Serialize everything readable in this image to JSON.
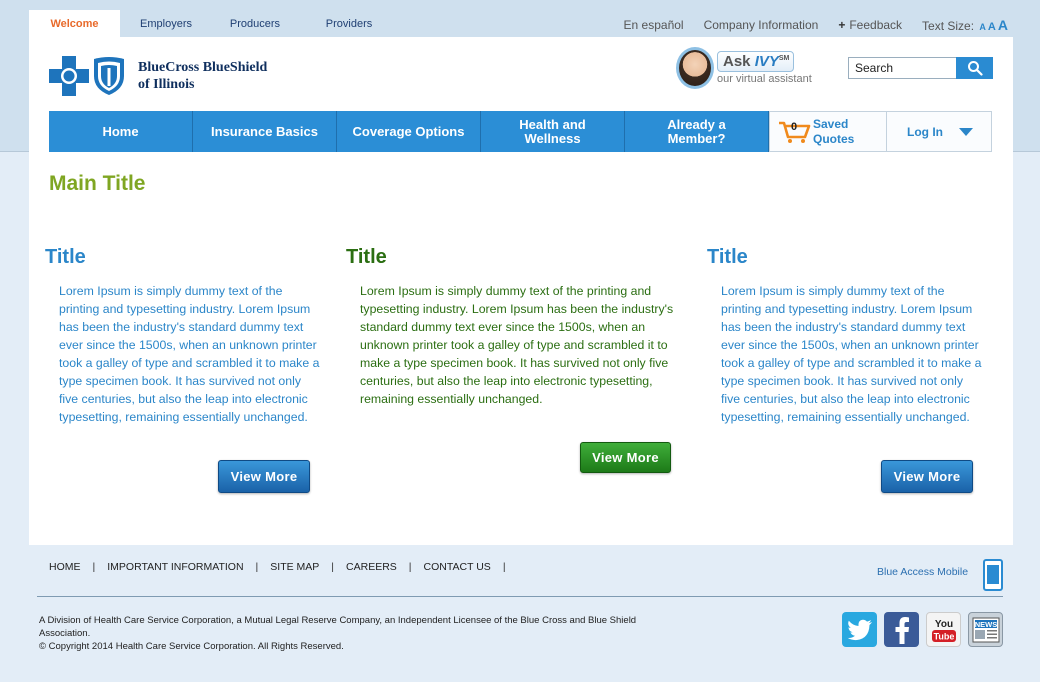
{
  "audience_tabs": [
    {
      "label": "Welcome",
      "active": true
    },
    {
      "label": "Employers",
      "active": false
    },
    {
      "label": "Producers",
      "active": false
    },
    {
      "label": "Providers",
      "active": false
    }
  ],
  "util": {
    "spanish": "En español",
    "company": "Company Information",
    "feedback_icon": "plus-icon",
    "feedback": "Feedback",
    "text_size_label": "Text Size:",
    "text_size_glyph": "A"
  },
  "logo": {
    "line1": "BlueCross BlueShield",
    "line2": "of Illinois"
  },
  "ivy": {
    "ask": "Ask",
    "name": "IVY",
    "mark": "SM",
    "sub": "our virtual assistant"
  },
  "search": {
    "value": "Search"
  },
  "nav": {
    "items": [
      {
        "label": "Home"
      },
      {
        "label": "Insurance Basics"
      },
      {
        "label": "Coverage Options"
      },
      {
        "label": "Health and Wellness"
      },
      {
        "label": "Already a Member?"
      }
    ],
    "quotes_count": "0",
    "quotes_label": "Saved Quotes",
    "login": "Log In"
  },
  "main": {
    "title": "Main Title",
    "columns": [
      {
        "title": "Title",
        "body": "Lorem Ipsum is simply dummy text of the printing and typesetting industry. Lorem Ipsum has been the industry's standard dummy text ever since the 1500s, when an unknown printer took a galley of type and scrambled it to make a type specimen book. It has survived not only five centuries, but also the leap into electronic typesetting, remaining essentially unchanged.",
        "button": "View More"
      },
      {
        "title": "Title",
        "body": "Lorem Ipsum is simply dummy text of the printing and typesetting industry. Lorem Ipsum has been the industry's standard dummy text ever since the 1500s, when an unknown printer took a galley of type and scrambled it to make a type specimen book. It has survived not only five centuries, but also the leap into electronic typesetting, remaining essentially unchanged.",
        "button": "View More"
      },
      {
        "title": "Title",
        "body": "Lorem Ipsum is simply dummy text of the printing and typesetting industry. Lorem Ipsum has been the industry's standard dummy text ever since the 1500s, when an unknown printer took a galley of type and scrambled it to make a type specimen book. It has survived not only five centuries, but also the leap into electronic typesetting, remaining essentially unchanged.",
        "button": "View More"
      }
    ]
  },
  "footer": {
    "links": [
      "HOME",
      "IMPORTANT INFORMATION",
      "SITE MAP",
      "CAREERS",
      "CONTACT US"
    ],
    "separator": "|",
    "mobile": "Blue Access Mobile",
    "legal_line1": "A Division of Health Care Service Corporation, a Mutual Legal Reserve Company, an Independent Licensee of the Blue Cross and Blue Shield Association.",
    "legal_line2": "© Copyright 2014 Health Care Service Corporation. All Rights Reserved.",
    "social": [
      {
        "icon": "twitter-icon"
      },
      {
        "icon": "facebook-icon"
      },
      {
        "icon": "youtube-icon",
        "label": "You Tube"
      },
      {
        "icon": "news-icon",
        "label": "NEWS"
      }
    ]
  },
  "colors": {
    "brand_blue": "#2b8ed6",
    "main_title_green": "#7fa622",
    "dark_green": "#2b6e12",
    "tab_active": "#e86a2b"
  }
}
